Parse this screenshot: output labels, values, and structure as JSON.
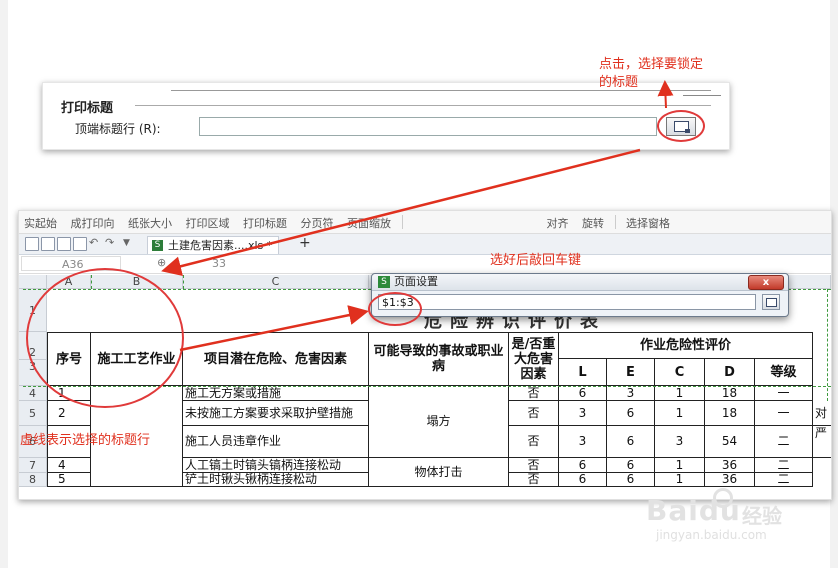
{
  "print_title": {
    "heading": "打印标题",
    "row_label": "顶端标题行 (R):",
    "row_value": ""
  },
  "annotations": {
    "click_note": "点击，选择要锁定\n的标题",
    "enter_note": "选好后敲回车键",
    "dashed_note": "虚线表示选择的标题行",
    "accent_color": "#e0301e",
    "dash_color": "#3f9a3f"
  },
  "toolbar": {
    "items": [
      "实起始",
      "成打印向",
      "纸张大小",
      "打印区域",
      "打印标题",
      "分页符",
      "页面缩放",
      "",
      "",
      "对齐",
      "旋转",
      "选择窗格"
    ]
  },
  "doc_tab": {
    "label": "土建危害因素....xls *",
    "icon": "spreadsheet-icon"
  },
  "formula_bar": {
    "name_box": "A36",
    "value": "33"
  },
  "dialog": {
    "title": "页面设置",
    "range": "$1:$3",
    "close_label": "x"
  },
  "sheet": {
    "columns": [
      "A",
      "B",
      "C"
    ],
    "row_numbers": [
      "1",
      "2",
      "3",
      "4",
      "5",
      "6",
      "7",
      "8"
    ],
    "title_text": "危险辨识评价表",
    "headers": {
      "no": "序号",
      "process": "施工工艺作业",
      "hazard": "项目潜在危险、危害因素",
      "accident": "可能导致的事故或职业病",
      "major": "是/否重大危害因素",
      "evaluation": "作业危险性评价",
      "L": "L",
      "E": "E",
      "C": "C",
      "D": "D",
      "grade": "等级"
    },
    "rows": [
      {
        "no": "1",
        "hazard": "施工无方案或措施",
        "major": "否",
        "L": "6",
        "E": "3",
        "C": "1",
        "D": "18",
        "grade": "一"
      },
      {
        "no": "2",
        "hazard": "未按施工方案要求采取护壁措施",
        "major": "否",
        "L": "3",
        "E": "6",
        "C": "1",
        "D": "18",
        "grade": "一",
        "extra": "对"
      },
      {
        "no": "",
        "hazard": "施工人员违章作业",
        "major": "否",
        "L": "3",
        "E": "6",
        "C": "3",
        "D": "54",
        "grade": "二",
        "extra": "严"
      },
      {
        "no": "4",
        "hazard": "人工镐土时镐头镐柄连接松动",
        "major": "否",
        "L": "6",
        "E": "6",
        "C": "1",
        "D": "36",
        "grade": "二"
      },
      {
        "no": "5",
        "hazard": "铲土时锹头锹柄连接松动",
        "major": "否",
        "L": "6",
        "E": "6",
        "C": "1",
        "D": "36",
        "grade": "二"
      }
    ],
    "accident_groups": [
      "塌方",
      "物体打击"
    ]
  },
  "watermark": {
    "brand": "Baidu",
    "cn": "经验",
    "url": "jingyan.baidu.com"
  }
}
